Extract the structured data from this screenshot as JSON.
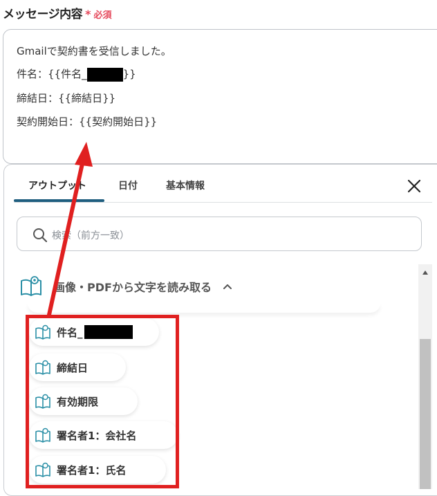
{
  "field": {
    "label": "メッセージ内容",
    "required_mark": "*",
    "required_text": "必須"
  },
  "message": {
    "line1": "Gmailで契約書を受信しました。",
    "line2_prefix": "件名：{{件名_",
    "line2_suffix": "}}",
    "line3": "締結日：{{締結日}}",
    "line4": "契約開始日：{{契約開始日}}"
  },
  "tabs": [
    {
      "label": "アウトプット",
      "active": true
    },
    {
      "label": "日付",
      "active": false
    },
    {
      "label": "基本情報",
      "active": false
    }
  ],
  "search": {
    "placeholder": "検索（前方一致）"
  },
  "group": {
    "title": "画像・PDFから文字を読み取る",
    "expanded": true
  },
  "items": [
    {
      "label": "件名_"
    },
    {
      "label": "締結日"
    },
    {
      "label": "有効期限"
    },
    {
      "label": "署名者1：会社名"
    },
    {
      "label": "署名者1：氏名"
    }
  ],
  "colors": {
    "required": "#e5485b",
    "tab_active": "#1f5e7f",
    "annotation": "#e02020"
  },
  "icons": [
    "search-icon",
    "close-icon",
    "open-book-icon",
    "chevron-up-icon",
    "scroll-up-arrow-icon"
  ]
}
